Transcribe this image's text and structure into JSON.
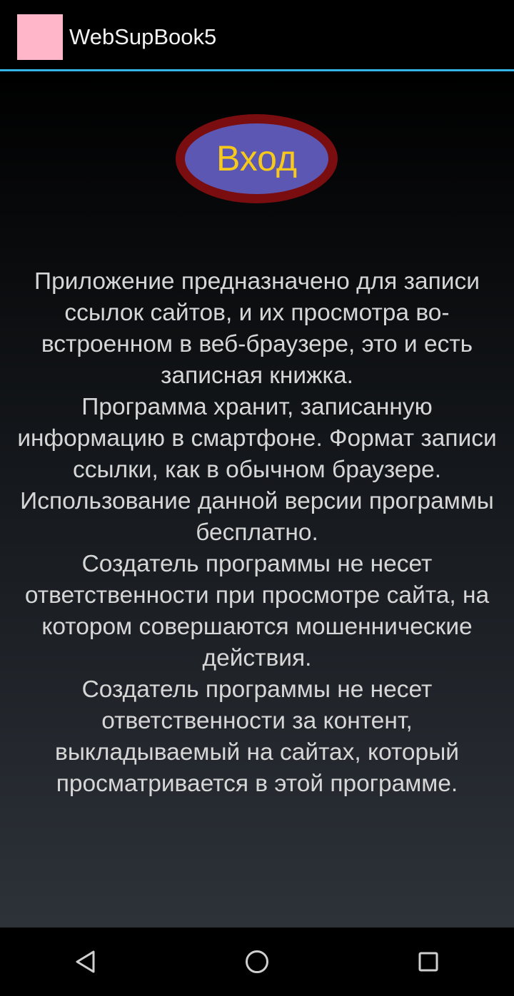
{
  "action_bar": {
    "icon": "app-icon",
    "icon_color": "#ffb6c8",
    "title": "WebSupBook5",
    "divider_color": "#33b5e5"
  },
  "main": {
    "login_button": {
      "label": "Вход",
      "fill_color": "#5b57b2",
      "border_color": "#7a0d10",
      "text_color": "#f7c91b"
    },
    "description": [
      "Приложение предназначено для записи ссылок сайтов, и их просмотра во-встроенном в веб-браузере, это и есть записная книжка.",
      "Программа хранит, записанную информацию в смартфоне. Формат записи ссылки, как в обычном браузере.",
      "Использование данной версии программы бесплатно.",
      "Создатель программы не несет ответственности при просмотре сайта, на котором совершаются мошеннические действия.",
      "Создатель программы не несет ответственности за контент, выкладываемый на сайтах, который просматривается в этой программе."
    ]
  },
  "nav_bar": {
    "back_icon": "back-triangle-icon",
    "home_icon": "home-circle-icon",
    "recents_icon": "recents-square-icon"
  }
}
